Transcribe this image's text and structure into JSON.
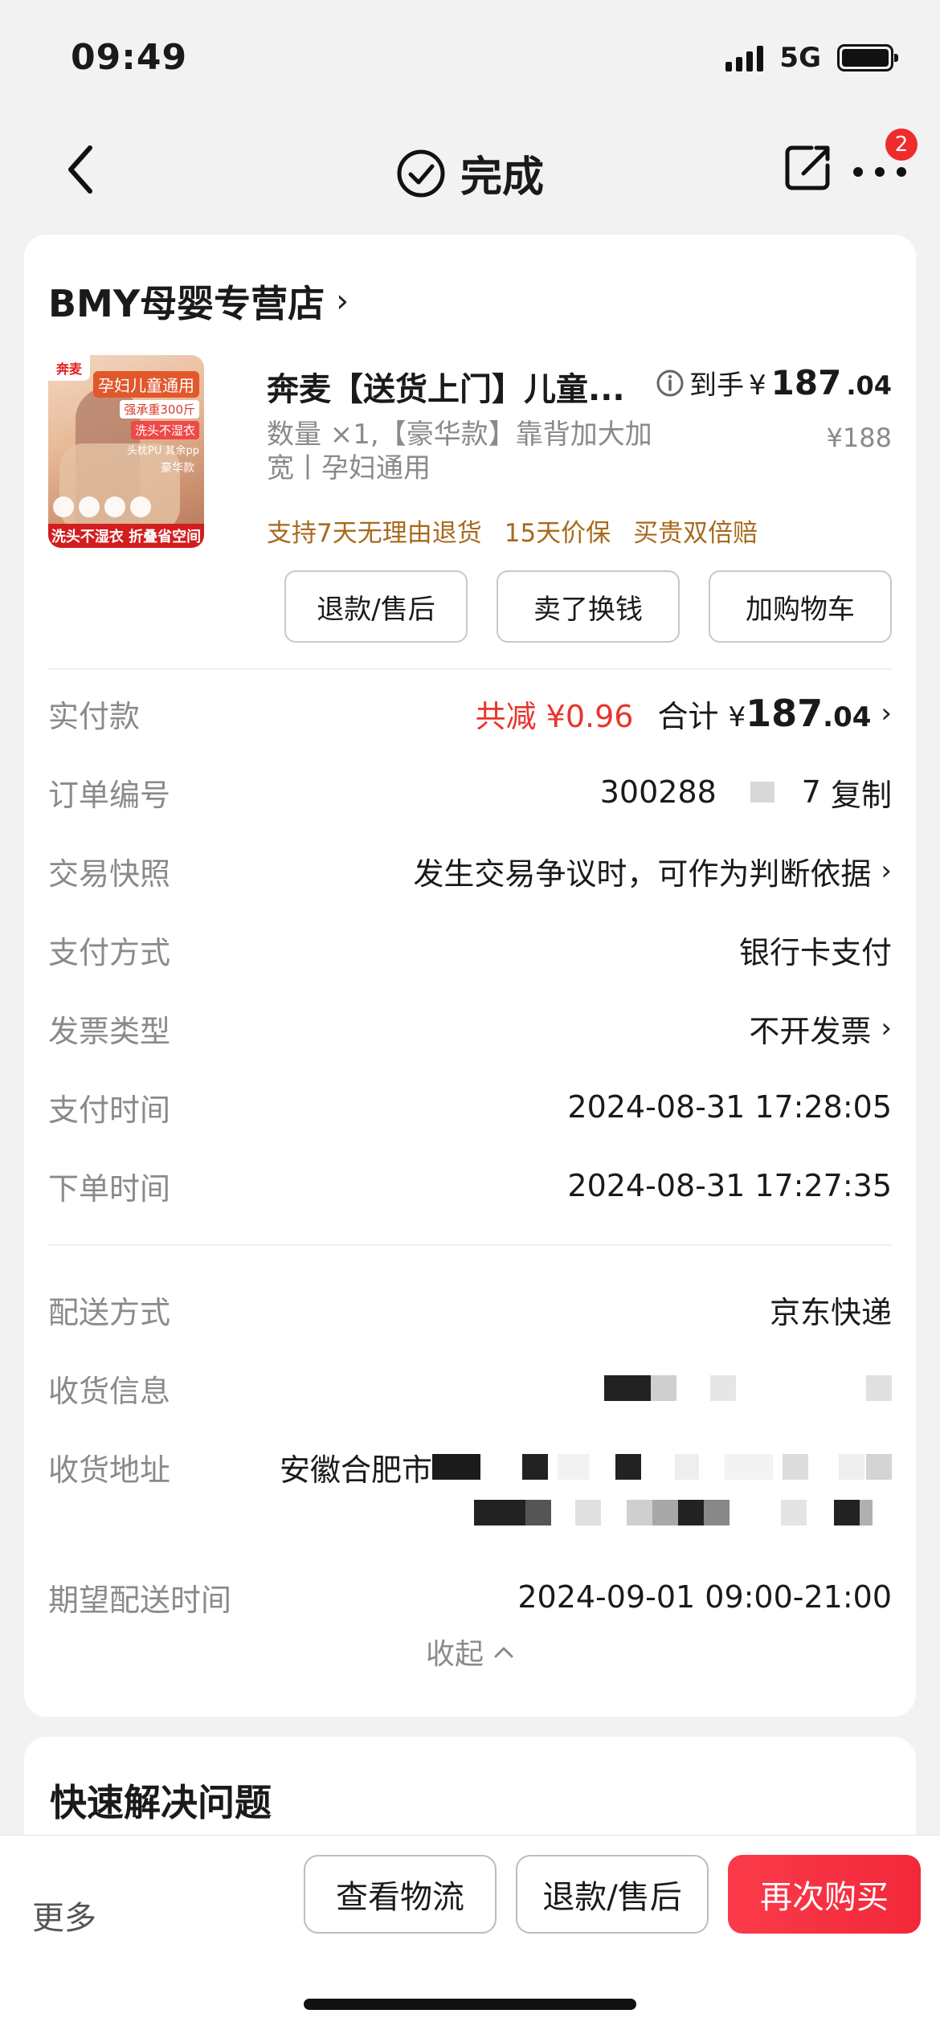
{
  "status_bar": {
    "time": "09:49",
    "network": "5G"
  },
  "nav": {
    "title": "完成",
    "badge_count": "2"
  },
  "store": {
    "name": "BMY母婴专营店"
  },
  "product": {
    "image_labels": {
      "brand_tag": "奔麦",
      "headline": "孕妇儿童通用",
      "line1": "强承重300斤",
      "line2": "洗头不湿衣",
      "line3": "头枕PU 其余pp",
      "line4": "豪华款",
      "bottom": "洗头不湿衣 折叠省空间"
    },
    "title": "奔麦【送货上门】儿童...",
    "price_prefix": "到手",
    "price_yen": "¥",
    "price_int": "187",
    "price_dec": ".04",
    "original_price": "¥188",
    "spec": "数量 ×1,【豪华款】靠背加大加宽丨孕妇通用",
    "guarantees": [
      "支持7天无理由退货",
      "15天价保",
      "买贵双倍赔"
    ],
    "buttons": [
      "退款/售后",
      "卖了换钱",
      "加购物车"
    ]
  },
  "details": {
    "paid": {
      "label": "实付款",
      "discount": "共减 ¥0.96",
      "total_prefix": "合计",
      "total_yen": "¥",
      "total_int": "187",
      "total_dec": ".04"
    },
    "order_no": {
      "label": "订单编号",
      "value_a": "300288",
      "value_b": "7",
      "copy": "复制"
    },
    "snapshot": {
      "label": "交易快照",
      "value": "发生交易争议时，可作为判断依据"
    },
    "payment": {
      "label": "支付方式",
      "value": "银行卡支付"
    },
    "invoice": {
      "label": "发票类型",
      "value": "不开发票"
    },
    "pay_time": {
      "label": "支付时间",
      "value": "2024-08-31 17:28:05"
    },
    "order_time": {
      "label": "下单时间",
      "value": "2024-08-31 17:27:35"
    },
    "delivery": {
      "label": "配送方式",
      "value": "京东快递"
    },
    "receiver": {
      "label": "收货信息"
    },
    "address": {
      "label": "收货地址",
      "value": "安徽合肥市"
    },
    "expected_time": {
      "label": "期望配送时间",
      "value": "2024-09-01 09:00-21:00"
    },
    "collapse": "收起"
  },
  "quick_solve": {
    "title": "快速解决问题"
  },
  "bottom_bar": {
    "more": "更多",
    "logistics": "查看物流",
    "refund": "退款/售后",
    "rebuy": "再次购买"
  },
  "colors": {
    "accent_red": "#f2283a",
    "discount_red": "#e8352b",
    "guarantee_brown": "#a8691d"
  }
}
